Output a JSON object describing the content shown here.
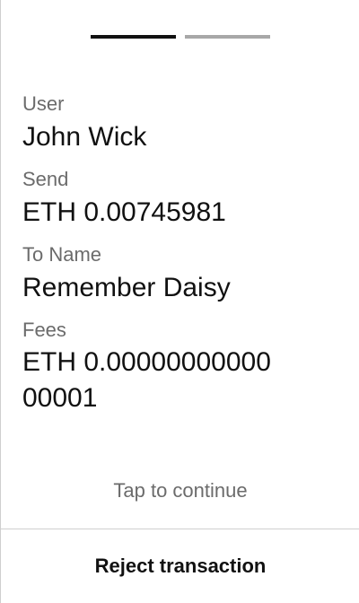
{
  "stepper": {
    "total_steps": 2,
    "current_step": 1,
    "active_color": "#111111",
    "inactive_color": "#a8a8a8"
  },
  "fields": [
    {
      "label": "User",
      "value": "John Wick"
    },
    {
      "label": "Send",
      "value": "ETH 0.00745981"
    },
    {
      "label": "To Name",
      "value": "Remember Daisy"
    },
    {
      "label": "Fees",
      "value": "ETH 0.00000000000\n00001"
    }
  ],
  "footer": {
    "tap_hint": "Tap to continue",
    "reject_label": "Reject transaction"
  }
}
